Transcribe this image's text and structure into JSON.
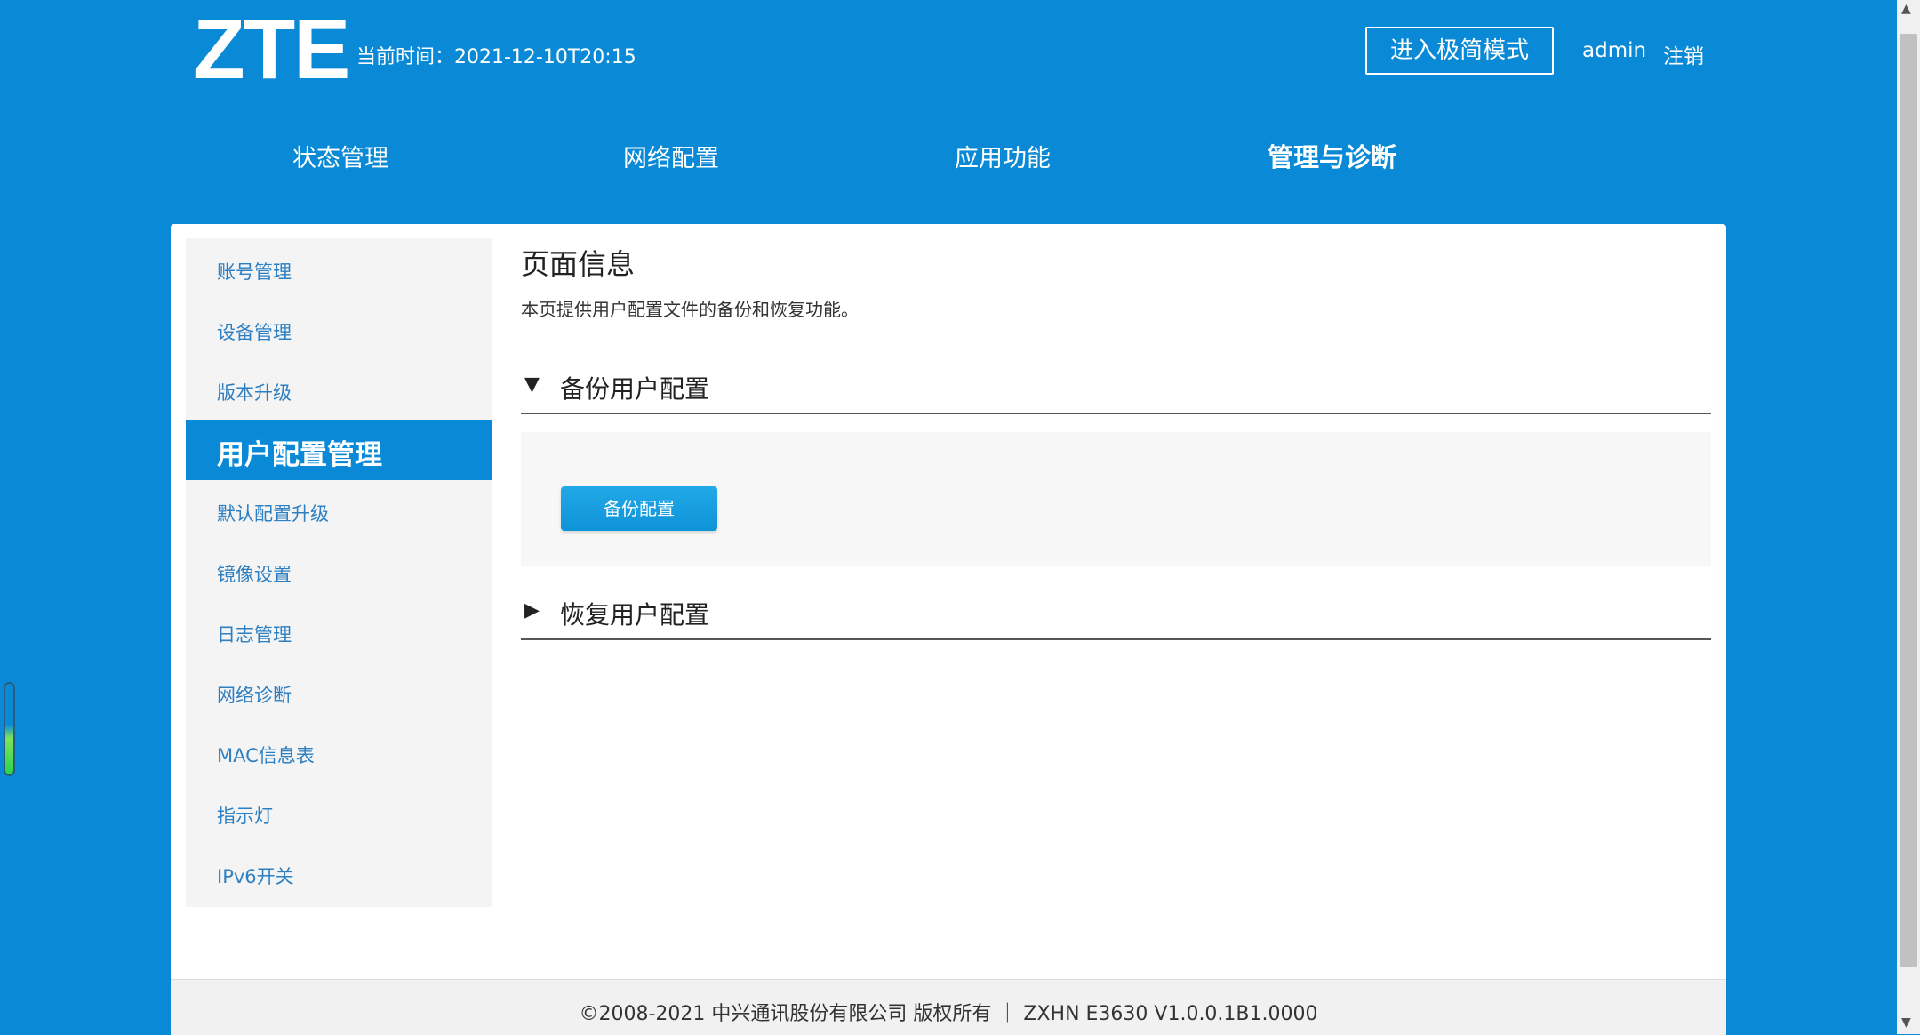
{
  "header": {
    "logo": "ZTE",
    "current_time": "当前时间：2021-12-10T20:15",
    "simple_mode_button": "进入极简模式",
    "username": "admin",
    "logout": "注销"
  },
  "nav": {
    "items": [
      {
        "label": "状态管理"
      },
      {
        "label": "网络配置"
      },
      {
        "label": "应用功能"
      },
      {
        "label": "管理与诊断"
      }
    ],
    "active": "管理与诊断"
  },
  "sidebar": {
    "items": [
      {
        "label": "账号管理"
      },
      {
        "label": "设备管理"
      },
      {
        "label": "版本升级"
      },
      {
        "label": "用户配置管理"
      },
      {
        "label": "默认配置升级"
      },
      {
        "label": "镜像设置"
      },
      {
        "label": "日志管理"
      },
      {
        "label": "网络诊断"
      },
      {
        "label": "MAC信息表"
      },
      {
        "label": "指示灯"
      },
      {
        "label": "IPv6开关"
      }
    ],
    "active": "用户配置管理"
  },
  "main": {
    "title": "页面信息",
    "description": "本页提供用户配置文件的备份和恢复功能。",
    "backup_section": {
      "expanded_icon": "▼",
      "title": "备份用户配置",
      "button": "备份配置"
    },
    "restore_section": {
      "collapsed_icon": "▶",
      "title": "恢复用户配置"
    }
  },
  "footer": {
    "text": "©2008-2021 中兴通讯股份有限公司 版权所有 ｜  ZXHN E3630 V1.0.0.1B1.0000"
  },
  "colors": {
    "brand_blue": "#0a8ad6",
    "link_blue": "#2d7fc1",
    "button_blue": "#1ba0e2"
  },
  "icons": {
    "scroll_up": "triangle-up-icon",
    "scroll_down": "triangle-down-icon"
  }
}
